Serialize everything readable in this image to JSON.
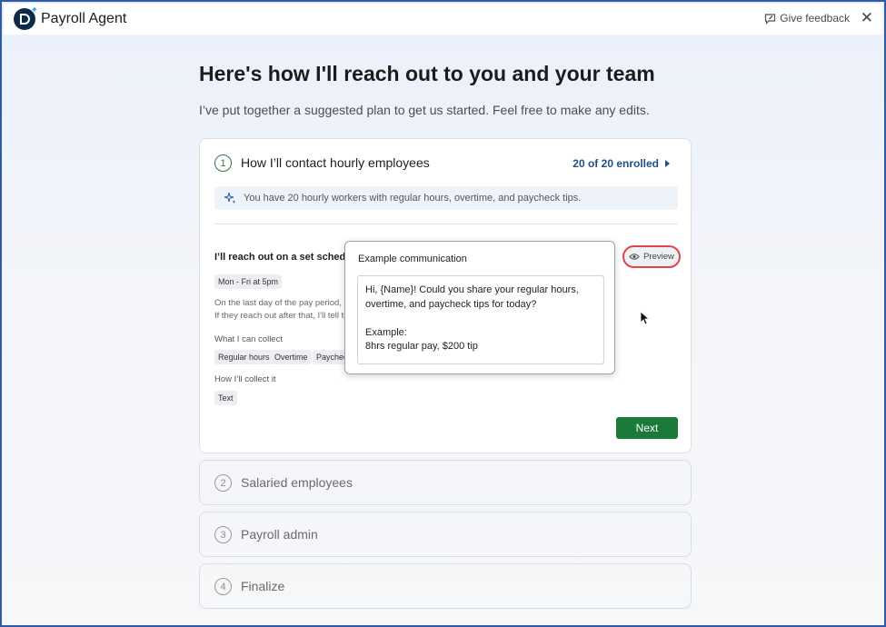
{
  "app": {
    "title": "Payroll Agent",
    "feedback_label": "Give feedback",
    "close_glyph": "✕"
  },
  "page": {
    "heading": "Here's how I'll reach out to you and your team",
    "subheading": "I’ve put together a suggested plan to get us started. Feel free to make any edits."
  },
  "step1": {
    "number": "1",
    "title": "How I’ll contact hourly employees",
    "enrolled": "20 of 20 enrolled",
    "info": "You have 20 hourly workers with regular hours, overtime, and paycheck tips.",
    "schedule_title": "I’ll reach out on a set schedule",
    "schedule_chip": "Mon - Fri at 5pm",
    "desc_line1": "On the last day of the pay period, I'll",
    "desc_line2": "If they reach out after that, I'll tell th",
    "collect_label": "What I can collect",
    "collect_chips": [
      "Regular hours",
      "Overtime",
      "Paycheck tips"
    ],
    "method_label": "How I’ll collect it",
    "method_chip": "Text",
    "next_label": "Next",
    "preview_label": "Preview"
  },
  "popup": {
    "title": "Example communication",
    "line1": "Hi, {Name}! Could you share your regular hours,",
    "line2": "overtime, and paycheck tips for today?",
    "line3": "Example:",
    "line4": "8hrs regular pay, $200 tip"
  },
  "steps": [
    {
      "number": "2",
      "title": "Salaried employees"
    },
    {
      "number": "3",
      "title": "Payroll admin"
    },
    {
      "number": "4",
      "title": "Finalize"
    }
  ],
  "colors": {
    "accent_green": "#1b7a3a",
    "link_blue": "#1f4f86",
    "highlight_red": "#e0454a"
  },
  "icons": {
    "logo": "payroll-agent-logo",
    "feedback": "feedback-icon",
    "sparkle": "sparkle-icon",
    "eye": "eye-icon",
    "arrow": "chevron-right-icon"
  }
}
